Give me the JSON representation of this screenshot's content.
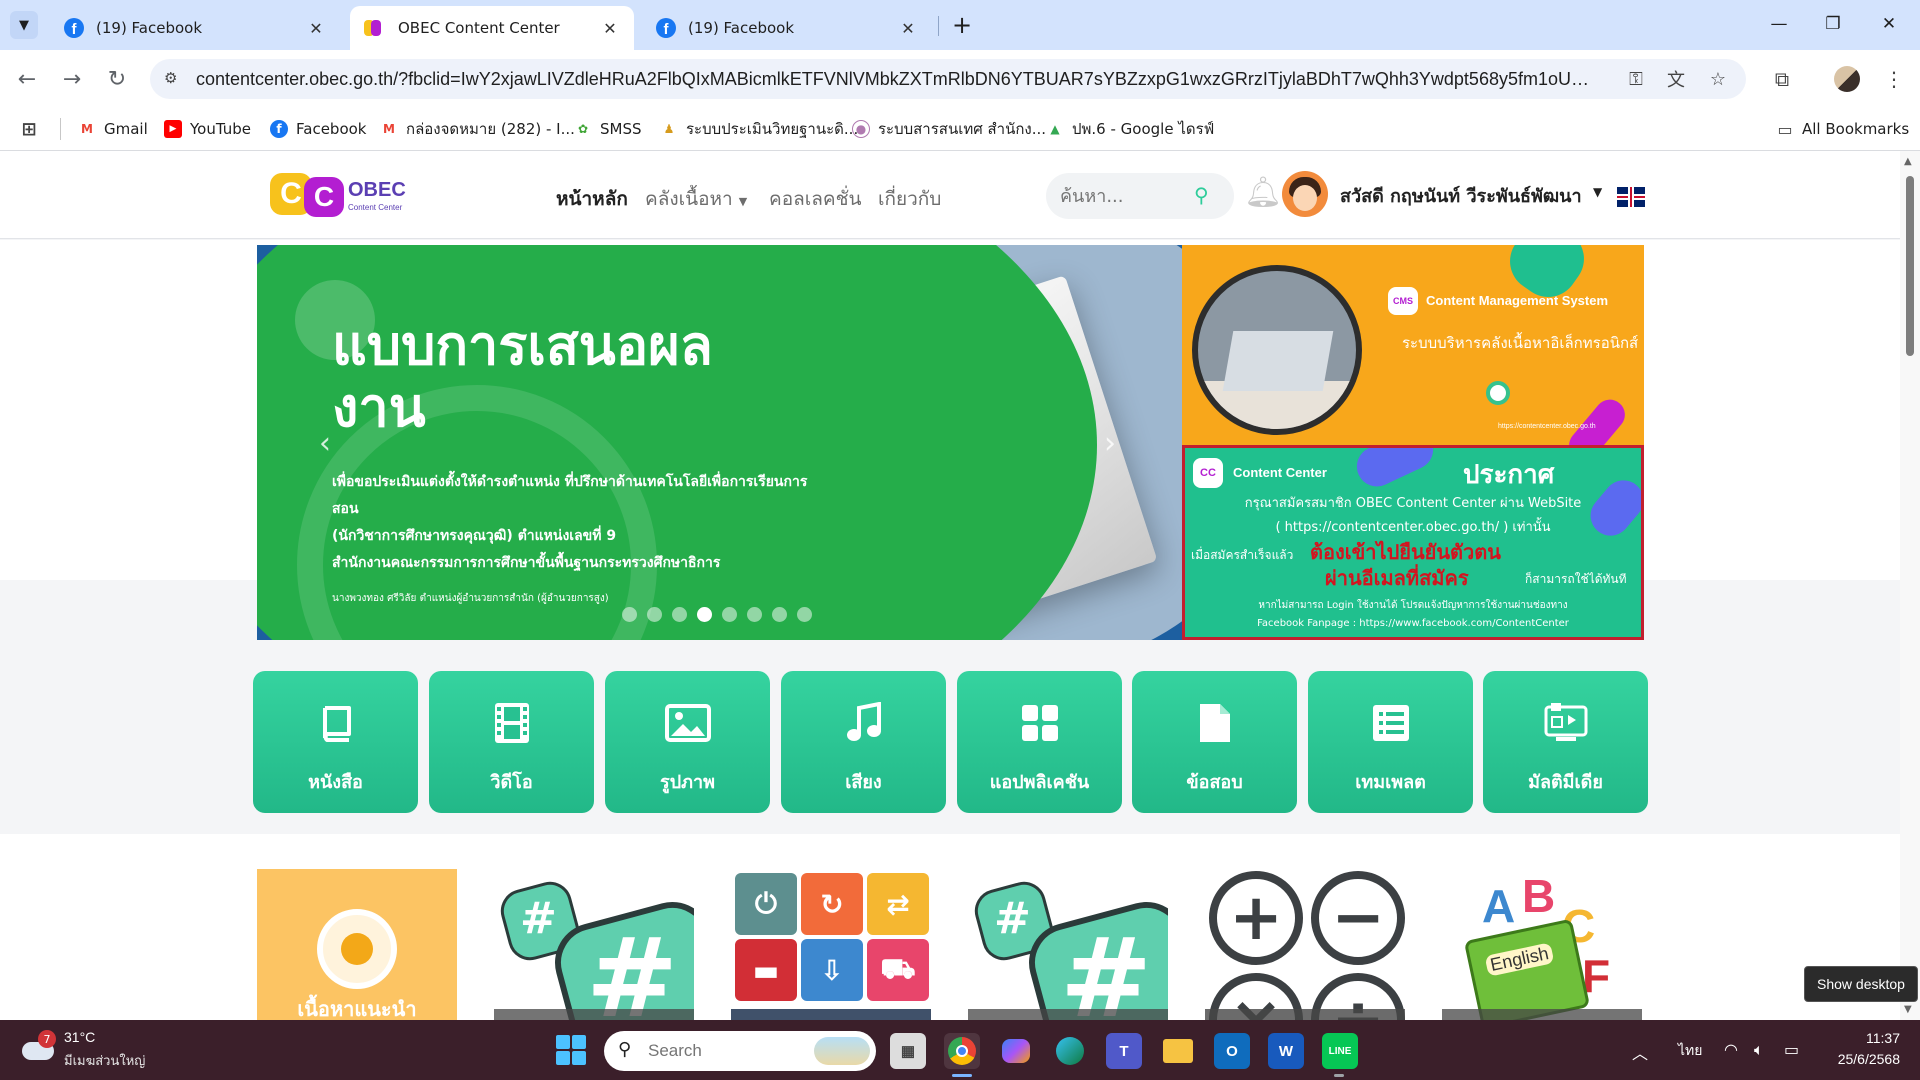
{
  "browser": {
    "tabs": [
      {
        "title": "(19) Facebook",
        "icon": "facebook-icon"
      },
      {
        "title": "OBEC Content Center",
        "icon": "obec-icon"
      },
      {
        "title": "(19) Facebook",
        "icon": "facebook-icon"
      }
    ],
    "url": "contentcenter.obec.go.th/?fbclid=IwY2xjawLIVZdleHRuA2FlbQIxMABicmlkETFVNlVMbkZXTmRlbDN6YTBUAR7sYBZzxpG1wxzGRrzITjylaBDhT7wQhh3Ywdpt568y5fm1oUONUe_SDrhnj...",
    "bookmarks": [
      {
        "label": "Gmail",
        "icon": "gmail-icon"
      },
      {
        "label": "YouTube",
        "icon": "youtube-icon"
      },
      {
        "label": "Facebook",
        "icon": "facebook-icon"
      },
      {
        "label": "กล่องจดหมาย (282) - I...",
        "icon": "gmail-icon"
      },
      {
        "label": "SMSS",
        "icon": "smss-icon"
      },
      {
        "label": "ระบบประเมินวิทยฐานะดิ...",
        "icon": "person-icon"
      },
      {
        "label": "ระบบสารสนเทศ สำนักง...",
        "icon": "info-icon"
      },
      {
        "label": "ปพ.6 - Google ไดรฟ์",
        "icon": "google-drive-icon"
      }
    ],
    "all_bookmarks": "All Bookmarks"
  },
  "site": {
    "logo_brand": "OBEC",
    "logo_sub": "Content Center",
    "menu": [
      "หน้าหลัก",
      "คลังเนื้อหา",
      "คอลเลคชั่น",
      "เกี่ยวกับ"
    ],
    "search_placeholder": "ค้นหา...",
    "greeting": "สวัสดี กฤษนันท์ วีระพันธ์พัฒนา"
  },
  "slider": {
    "title": "แบบการเสนอผลงาน",
    "desc": [
      "เพื่อขอประเมินแต่งตั้งให้ดำรงตำแหน่ง ที่ปรึกษาด้านเทคโนโลยีเพื่อการเรียนการสอน",
      "(นักวิชาการศึกษาทรงคุณวุฒิ) ตำแหน่งเลขที่ 9",
      "สำนักงานคณะกรรมการการศึกษาขั้นพื้นฐานกระทรวงศึกษาธิการ"
    ],
    "credit": "นางพวงทอง ศรีวิลัย ตำแหน่งผู้อำนวยการสำนัก (ผู้อำนวยการสูง)",
    "dot_count": 8,
    "active_dot": 4
  },
  "banner1": {
    "logo": "CMS",
    "title": "Content Management System",
    "subtitle": "ระบบบริหารคลังเนื้อหาอิเล็กทรอนิกส์",
    "url": "https://contentcenter.obec.go.th"
  },
  "banner2": {
    "logo": "CC",
    "brand": "Content Center",
    "heading": "ประกาศ",
    "line1": "กรุณาสมัครสมาชิก OBEC Content Center ผ่าน WebSite",
    "line2": "( https://contentcenter.obec.go.th/ ) เท่านั้น",
    "pre": "เมื่อสมัครสำเร็จแล้ว",
    "red1": "ต้องเข้าไปยืนยันตัวตน",
    "red2": "ผ่านอีเมลที่สมัคร",
    "post": "ก็สามารถใช้ได้ทันที",
    "line3": "หากไม่สามารถ Login ใช้งานได้ โปรดแจ้งปัญหาการใช้งานผ่านช่องทาง",
    "line4": "Facebook Fanpage : https://www.facebook.com/ContentCenter"
  },
  "categories": [
    {
      "label": "หนังสือ",
      "icon": "book-icon"
    },
    {
      "label": "วิดีโอ",
      "icon": "film-icon"
    },
    {
      "label": "รูปภาพ",
      "icon": "image-icon"
    },
    {
      "label": "เสียง",
      "icon": "music-icon"
    },
    {
      "label": "แอปพลิเคชัน",
      "icon": "apps-grid-icon"
    },
    {
      "label": "ข้อสอบ",
      "icon": "document-icon"
    },
    {
      "label": "เทมเพลต",
      "icon": "list-icon"
    },
    {
      "label": "มัลติมีเดีย",
      "icon": "multimedia-icon"
    }
  ],
  "cards": {
    "featured_label": "เนื้อหาแนะนำ",
    "english_label": "English"
  },
  "show_desktop": "Show desktop",
  "taskbar": {
    "weather_temp": "31°C",
    "weather_badge": "7",
    "weather_location": "มีเมฆส่วนใหญ่",
    "search_placeholder": "Search",
    "lang": "ไทย",
    "time": "11:37",
    "date": "25/6/2568"
  },
  "colors": {
    "tab_strip": "#d3e3fd",
    "tile_green": "#22b888",
    "slide_green": "#25ad4a",
    "banner_orange": "#f8a71b",
    "announce_red": "#d3141f",
    "taskbar": "#3b1f2a"
  }
}
